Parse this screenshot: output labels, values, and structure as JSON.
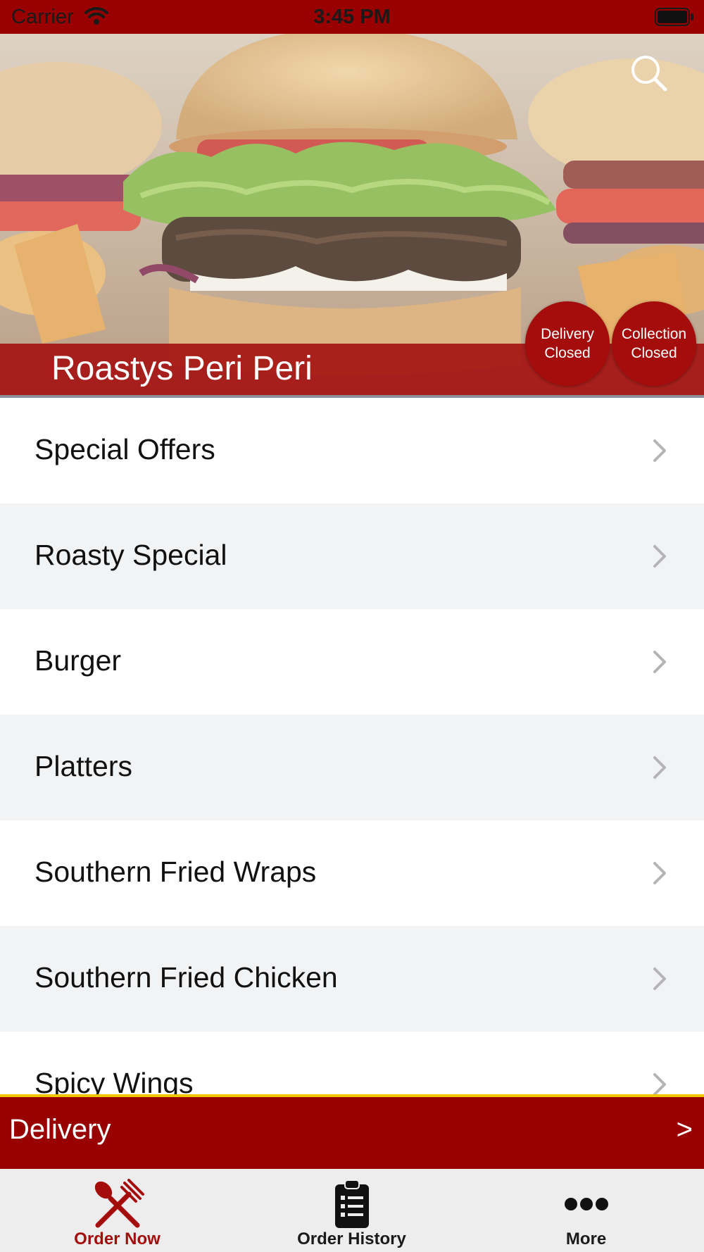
{
  "status_bar": {
    "carrier": "Carrier",
    "time": "3:45 PM"
  },
  "header": {
    "restaurant_name": "Roastys Peri Peri",
    "search_icon": "search-icon",
    "badges": {
      "delivery": {
        "line1": "Delivery",
        "line2": "Closed"
      },
      "collection": {
        "line1": "Collection",
        "line2": "Closed"
      }
    }
  },
  "menu": {
    "items": [
      {
        "label": "Special Offers"
      },
      {
        "label": "Roasty Special"
      },
      {
        "label": "Burger"
      },
      {
        "label": "Platters"
      },
      {
        "label": "Southern Fried Wraps"
      },
      {
        "label": "Southern Fried Chicken"
      },
      {
        "label": "Spicy Wings"
      }
    ],
    "chevron_icon": "chevron-right-icon"
  },
  "delivery_bar": {
    "label": "Delivery",
    "arrow": ">"
  },
  "tab_bar": {
    "tabs": [
      {
        "label": "Order Now",
        "icon": "fork-knife-icon",
        "active": true
      },
      {
        "label": "Order History",
        "icon": "clipboard-icon",
        "active": false
      },
      {
        "label": "More",
        "icon": "ellipsis-icon",
        "active": false
      }
    ]
  },
  "colors": {
    "brand_red": "#990000",
    "accent_yellow": "#f0c800",
    "active_tab": "#a50d0d",
    "row_alt": "#f2f3f5"
  }
}
